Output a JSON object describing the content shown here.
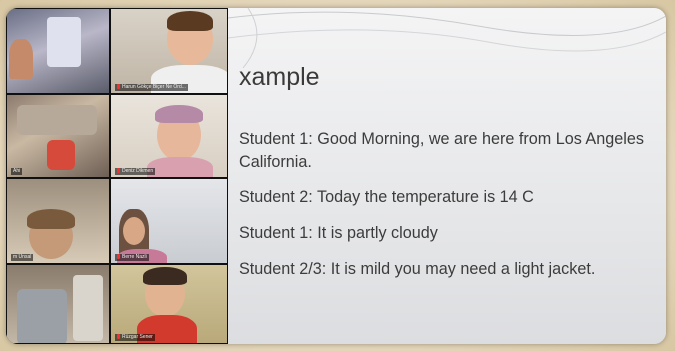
{
  "slide": {
    "title": "xample",
    "lines": [
      "Student 1:  Good Morning, we are here from Los Angeles",
      "California.",
      "Student 2: Today the temperature is 14 C",
      "Student 1: It is partly cloudy",
      "Student 2/3: It is mild you may need a light jacket."
    ]
  },
  "participants": [
    {
      "name": ""
    },
    {
      "name": "Harun Gökçe Biçer Ne Ord..."
    },
    {
      "name": "Ahi"
    },
    {
      "name": "Deniz Dikmen"
    },
    {
      "name": "m Unsal"
    },
    {
      "name": "Berre Nazli"
    },
    {
      "name": ""
    },
    {
      "name": "Rüzgar Sener"
    }
  ]
}
